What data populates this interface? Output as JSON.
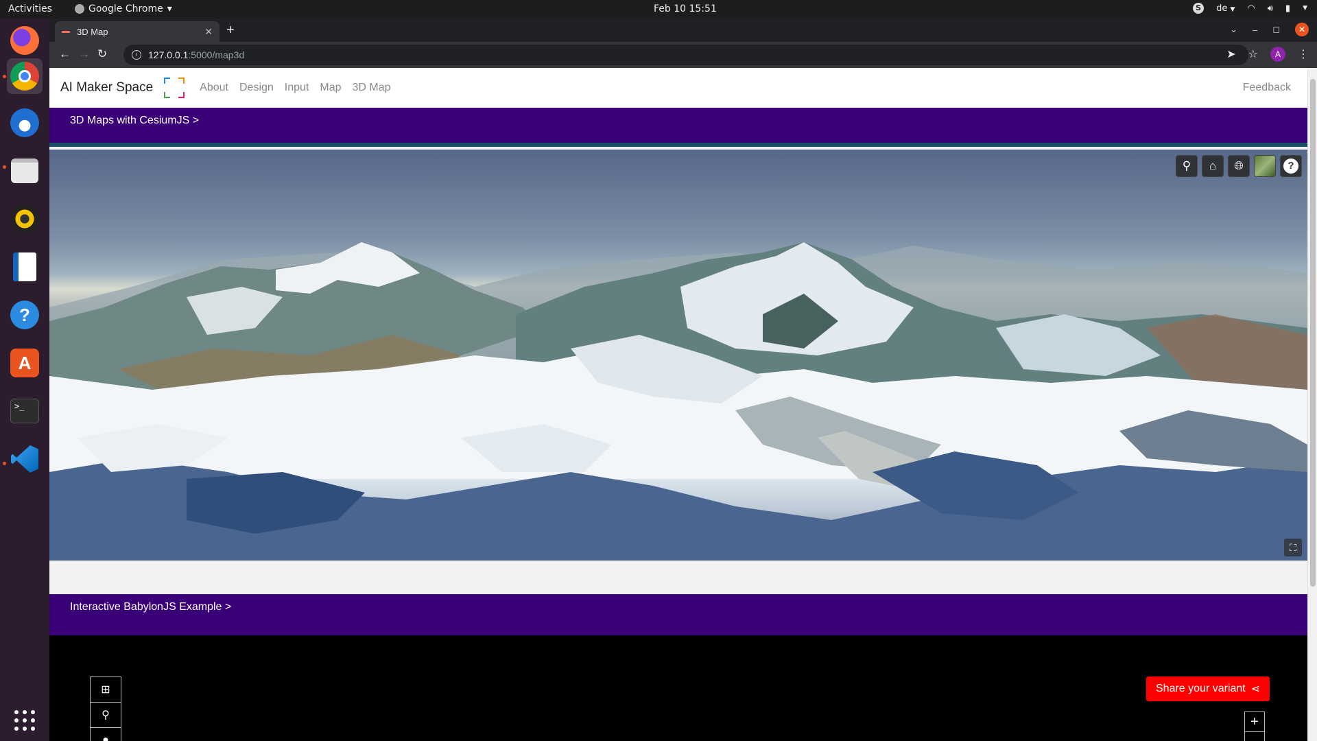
{
  "os": {
    "activities": "Activities",
    "app_name": "Google Chrome",
    "clock": "Feb 10  15:51",
    "keyboard": "de",
    "dock_apps": [
      "firefox-icon",
      "chrome-icon",
      "thunderbird-icon",
      "files-icon",
      "rhythmbox-icon",
      "libreoffice-writer-icon",
      "help-icon",
      "software-center-icon",
      "terminal-icon",
      "vscode-icon",
      "app-grid-icon"
    ]
  },
  "browser": {
    "tab_title": "3D Map",
    "url_host": "127.0.0.1",
    "url_path": ":5000/map3d",
    "profile_initial": "A"
  },
  "site": {
    "brand": "AI Maker Space",
    "nav": [
      "About",
      "Design",
      "Input",
      "Map",
      "3D Map"
    ],
    "feedback": "Feedback",
    "section1_title": "3D Maps with CesiumJS >",
    "section2_title": "Interactive BabylonJS Example >",
    "share_label": "Share your variant",
    "colors": {
      "band": "#3a0078",
      "share_button": "#ff0000"
    }
  }
}
